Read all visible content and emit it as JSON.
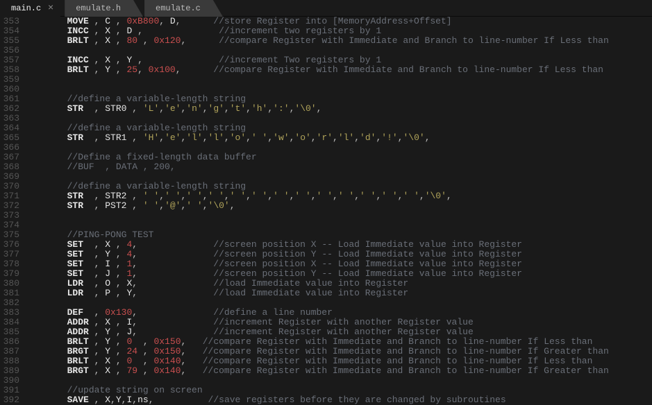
{
  "tabs": {
    "active": {
      "label": "main.c",
      "close": "×"
    },
    "others": [
      {
        "label": "emulate.h"
      },
      {
        "label": "emulate.c"
      }
    ]
  },
  "first_line": 353,
  "palette": {
    "mnemonic": "#e6e6e6",
    "register": "#e6e6e6",
    "number": "#c94f4f",
    "char": "#b0a35a",
    "comment": "#6a6f78",
    "punct": "#bfbfbf",
    "bg": "#1a1a1a"
  },
  "lines": [
    [
      {
        "c": "mn",
        "t": "MOVE"
      },
      {
        "c": "pn",
        "t": " , "
      },
      {
        "c": "rg",
        "t": "C"
      },
      {
        "c": "pn",
        "t": " , "
      },
      {
        "c": "nm",
        "t": "0xB800"
      },
      {
        "c": "pn",
        "t": ", "
      },
      {
        "c": "rg",
        "t": "D"
      },
      {
        "c": "pn",
        "t": ",      "
      },
      {
        "c": "cm",
        "t": "//store Register into [MemoryAddress+Offset]"
      }
    ],
    [
      {
        "c": "mn",
        "t": "INCC"
      },
      {
        "c": "pn",
        "t": " , "
      },
      {
        "c": "rg",
        "t": "X"
      },
      {
        "c": "pn",
        "t": " , "
      },
      {
        "c": "rg",
        "t": "D"
      },
      {
        "c": "pn",
        "t": " ,              "
      },
      {
        "c": "cm",
        "t": "//increment two registers by 1"
      }
    ],
    [
      {
        "c": "mn",
        "t": "BRLT"
      },
      {
        "c": "pn",
        "t": " , "
      },
      {
        "c": "rg",
        "t": "X"
      },
      {
        "c": "pn",
        "t": " , "
      },
      {
        "c": "nm",
        "t": "80"
      },
      {
        "c": "pn",
        "t": " , "
      },
      {
        "c": "nm",
        "t": "0x120"
      },
      {
        "c": "pn",
        "t": ",      "
      },
      {
        "c": "cm",
        "t": "//compare Register with Immediate and Branch to line-number If Less than"
      }
    ],
    [],
    [
      {
        "c": "mn",
        "t": "INCC"
      },
      {
        "c": "pn",
        "t": " , "
      },
      {
        "c": "rg",
        "t": "X"
      },
      {
        "c": "pn",
        "t": " , "
      },
      {
        "c": "rg",
        "t": "Y"
      },
      {
        "c": "pn",
        "t": " ,              "
      },
      {
        "c": "cm",
        "t": "//increment Two registers by 1"
      }
    ],
    [
      {
        "c": "mn",
        "t": "BRLT"
      },
      {
        "c": "pn",
        "t": " , "
      },
      {
        "c": "rg",
        "t": "Y"
      },
      {
        "c": "pn",
        "t": " , "
      },
      {
        "c": "nm",
        "t": "25"
      },
      {
        "c": "pn",
        "t": ", "
      },
      {
        "c": "nm",
        "t": "0x100"
      },
      {
        "c": "pn",
        "t": ",      "
      },
      {
        "c": "cm",
        "t": "//compare Register with Immediate and Branch to line-number If Less than"
      }
    ],
    [],
    [],
    [
      {
        "c": "cm",
        "t": "//define a variable-length string"
      }
    ],
    [
      {
        "c": "mn",
        "t": "STR "
      },
      {
        "c": "pn",
        "t": " , "
      },
      {
        "c": "rg",
        "t": "STR0"
      },
      {
        "c": "pn",
        "t": " , "
      },
      {
        "c": "ch",
        "t": "'L'"
      },
      {
        "c": "pn",
        "t": ","
      },
      {
        "c": "ch",
        "t": "'e'"
      },
      {
        "c": "pn",
        "t": ","
      },
      {
        "c": "ch",
        "t": "'n'"
      },
      {
        "c": "pn",
        "t": ","
      },
      {
        "c": "ch",
        "t": "'g'"
      },
      {
        "c": "pn",
        "t": ","
      },
      {
        "c": "ch",
        "t": "'t'"
      },
      {
        "c": "pn",
        "t": ","
      },
      {
        "c": "ch",
        "t": "'h'"
      },
      {
        "c": "pn",
        "t": ","
      },
      {
        "c": "ch",
        "t": "':'"
      },
      {
        "c": "pn",
        "t": ","
      },
      {
        "c": "ch",
        "t": "'\\0'"
      },
      {
        "c": "pn",
        "t": ","
      }
    ],
    [],
    [
      {
        "c": "cm",
        "t": "//define a variable-length string"
      }
    ],
    [
      {
        "c": "mn",
        "t": "STR "
      },
      {
        "c": "pn",
        "t": " , "
      },
      {
        "c": "rg",
        "t": "STR1"
      },
      {
        "c": "pn",
        "t": " , "
      },
      {
        "c": "ch",
        "t": "'H'"
      },
      {
        "c": "pn",
        "t": ","
      },
      {
        "c": "ch",
        "t": "'e'"
      },
      {
        "c": "pn",
        "t": ","
      },
      {
        "c": "ch",
        "t": "'l'"
      },
      {
        "c": "pn",
        "t": ","
      },
      {
        "c": "ch",
        "t": "'l'"
      },
      {
        "c": "pn",
        "t": ","
      },
      {
        "c": "ch",
        "t": "'o'"
      },
      {
        "c": "pn",
        "t": ","
      },
      {
        "c": "ch",
        "t": "' '"
      },
      {
        "c": "pn",
        "t": ","
      },
      {
        "c": "ch",
        "t": "'w'"
      },
      {
        "c": "pn",
        "t": ","
      },
      {
        "c": "ch",
        "t": "'o'"
      },
      {
        "c": "pn",
        "t": ","
      },
      {
        "c": "ch",
        "t": "'r'"
      },
      {
        "c": "pn",
        "t": ","
      },
      {
        "c": "ch",
        "t": "'l'"
      },
      {
        "c": "pn",
        "t": ","
      },
      {
        "c": "ch",
        "t": "'d'"
      },
      {
        "c": "pn",
        "t": ","
      },
      {
        "c": "ch",
        "t": "'!'"
      },
      {
        "c": "pn",
        "t": ","
      },
      {
        "c": "ch",
        "t": "'\\0'"
      },
      {
        "c": "pn",
        "t": ","
      }
    ],
    [],
    [
      {
        "c": "cm",
        "t": "//Define a fixed-length data buffer"
      }
    ],
    [
      {
        "c": "cm",
        "t": "//BUF  , DATA , 200,"
      }
    ],
    [],
    [
      {
        "c": "cm",
        "t": "//define a variable-length string"
      }
    ],
    [
      {
        "c": "mn",
        "t": "STR "
      },
      {
        "c": "pn",
        "t": " , "
      },
      {
        "c": "rg",
        "t": "STR2"
      },
      {
        "c": "pn",
        "t": " , "
      },
      {
        "c": "ch",
        "t": "' '"
      },
      {
        "c": "pn",
        "t": ","
      },
      {
        "c": "ch",
        "t": "' '"
      },
      {
        "c": "pn",
        "t": ","
      },
      {
        "c": "ch",
        "t": "' '"
      },
      {
        "c": "pn",
        "t": ","
      },
      {
        "c": "ch",
        "t": "' '"
      },
      {
        "c": "pn",
        "t": ","
      },
      {
        "c": "ch",
        "t": "' '"
      },
      {
        "c": "pn",
        "t": ","
      },
      {
        "c": "ch",
        "t": "' '"
      },
      {
        "c": "pn",
        "t": ","
      },
      {
        "c": "ch",
        "t": "' '"
      },
      {
        "c": "pn",
        "t": ","
      },
      {
        "c": "ch",
        "t": "' '"
      },
      {
        "c": "pn",
        "t": ","
      },
      {
        "c": "ch",
        "t": "' '"
      },
      {
        "c": "pn",
        "t": ","
      },
      {
        "c": "ch",
        "t": "' '"
      },
      {
        "c": "pn",
        "t": ","
      },
      {
        "c": "ch",
        "t": "' '"
      },
      {
        "c": "pn",
        "t": ","
      },
      {
        "c": "ch",
        "t": "' '"
      },
      {
        "c": "pn",
        "t": ","
      },
      {
        "c": "ch",
        "t": "' '"
      },
      {
        "c": "pn",
        "t": ","
      },
      {
        "c": "ch",
        "t": "'\\0'"
      },
      {
        "c": "pn",
        "t": ","
      }
    ],
    [
      {
        "c": "mn",
        "t": "STR "
      },
      {
        "c": "pn",
        "t": " , "
      },
      {
        "c": "rg",
        "t": "PST2"
      },
      {
        "c": "pn",
        "t": " , "
      },
      {
        "c": "ch",
        "t": "' '"
      },
      {
        "c": "pn",
        "t": ","
      },
      {
        "c": "ch",
        "t": "'@'"
      },
      {
        "c": "pn",
        "t": ","
      },
      {
        "c": "ch",
        "t": "' '"
      },
      {
        "c": "pn",
        "t": ","
      },
      {
        "c": "ch",
        "t": "'\\0'"
      },
      {
        "c": "pn",
        "t": ","
      }
    ],
    [],
    [],
    [
      {
        "c": "cm",
        "t": "//PING-PONG TEST"
      }
    ],
    [
      {
        "c": "mn",
        "t": "SET "
      },
      {
        "c": "pn",
        "t": " , "
      },
      {
        "c": "rg",
        "t": "X"
      },
      {
        "c": "pn",
        "t": " , "
      },
      {
        "c": "nm",
        "t": "4"
      },
      {
        "c": "pn",
        "t": ",              "
      },
      {
        "c": "cm",
        "t": "//screen position X -- Load Immediate value into Register"
      }
    ],
    [
      {
        "c": "mn",
        "t": "SET "
      },
      {
        "c": "pn",
        "t": " , "
      },
      {
        "c": "rg",
        "t": "Y"
      },
      {
        "c": "pn",
        "t": " , "
      },
      {
        "c": "nm",
        "t": "4"
      },
      {
        "c": "pn",
        "t": ",              "
      },
      {
        "c": "cm",
        "t": "//screen position Y -- Load Immediate value into Register"
      }
    ],
    [
      {
        "c": "mn",
        "t": "SET "
      },
      {
        "c": "pn",
        "t": " , "
      },
      {
        "c": "rg",
        "t": "I"
      },
      {
        "c": "pn",
        "t": " , "
      },
      {
        "c": "nm",
        "t": "1"
      },
      {
        "c": "pn",
        "t": ",              "
      },
      {
        "c": "cm",
        "t": "//screen position X -- Load Immediate value into Register"
      }
    ],
    [
      {
        "c": "mn",
        "t": "SET "
      },
      {
        "c": "pn",
        "t": " , "
      },
      {
        "c": "rg",
        "t": "J"
      },
      {
        "c": "pn",
        "t": " , "
      },
      {
        "c": "nm",
        "t": "1"
      },
      {
        "c": "pn",
        "t": ",              "
      },
      {
        "c": "cm",
        "t": "//screen position Y -- Load Immediate value into Register"
      }
    ],
    [
      {
        "c": "mn",
        "t": "LDR "
      },
      {
        "c": "pn",
        "t": " , "
      },
      {
        "c": "rg",
        "t": "O"
      },
      {
        "c": "pn",
        "t": " , "
      },
      {
        "c": "rg",
        "t": "X"
      },
      {
        "c": "pn",
        "t": ",              "
      },
      {
        "c": "cm",
        "t": "//load Immediate value into Register"
      }
    ],
    [
      {
        "c": "mn",
        "t": "LDR "
      },
      {
        "c": "pn",
        "t": " , "
      },
      {
        "c": "rg",
        "t": "P"
      },
      {
        "c": "pn",
        "t": " , "
      },
      {
        "c": "rg",
        "t": "Y"
      },
      {
        "c": "pn",
        "t": ",              "
      },
      {
        "c": "cm",
        "t": "//load Immediate value into Register"
      }
    ],
    [],
    [
      {
        "c": "mn",
        "t": "DEF "
      },
      {
        "c": "pn",
        "t": " , "
      },
      {
        "c": "nm",
        "t": "0x130"
      },
      {
        "c": "pn",
        "t": ",              "
      },
      {
        "c": "cm",
        "t": "//define a line number"
      }
    ],
    [
      {
        "c": "mn",
        "t": "ADDR"
      },
      {
        "c": "pn",
        "t": " , "
      },
      {
        "c": "rg",
        "t": "X"
      },
      {
        "c": "pn",
        "t": " , "
      },
      {
        "c": "rg",
        "t": "I"
      },
      {
        "c": "pn",
        "t": ",              "
      },
      {
        "c": "cm",
        "t": "//increment Register with another Register value"
      }
    ],
    [
      {
        "c": "mn",
        "t": "ADDR"
      },
      {
        "c": "pn",
        "t": " , "
      },
      {
        "c": "rg",
        "t": "Y"
      },
      {
        "c": "pn",
        "t": " , "
      },
      {
        "c": "rg",
        "t": "J"
      },
      {
        "c": "pn",
        "t": ",              "
      },
      {
        "c": "cm",
        "t": "//increment Register with another Register value"
      }
    ],
    [
      {
        "c": "mn",
        "t": "BRLT"
      },
      {
        "c": "pn",
        "t": " , "
      },
      {
        "c": "rg",
        "t": "Y"
      },
      {
        "c": "pn",
        "t": " , "
      },
      {
        "c": "nm",
        "t": "0"
      },
      {
        "c": "pn",
        "t": "  , "
      },
      {
        "c": "nm",
        "t": "0x150"
      },
      {
        "c": "pn",
        "t": ",   "
      },
      {
        "c": "cm",
        "t": "//compare Register with Immediate and Branch to line-number If Less than"
      }
    ],
    [
      {
        "c": "mn",
        "t": "BRGT"
      },
      {
        "c": "pn",
        "t": " , "
      },
      {
        "c": "rg",
        "t": "Y"
      },
      {
        "c": "pn",
        "t": " , "
      },
      {
        "c": "nm",
        "t": "24"
      },
      {
        "c": "pn",
        "t": " , "
      },
      {
        "c": "nm",
        "t": "0x150"
      },
      {
        "c": "pn",
        "t": ",   "
      },
      {
        "c": "cm",
        "t": "//compare Register with Immediate and Branch to line-number If Greater than"
      }
    ],
    [
      {
        "c": "mn",
        "t": "BRLT"
      },
      {
        "c": "pn",
        "t": " , "
      },
      {
        "c": "rg",
        "t": "X"
      },
      {
        "c": "pn",
        "t": " , "
      },
      {
        "c": "nm",
        "t": "0"
      },
      {
        "c": "pn",
        "t": "  , "
      },
      {
        "c": "nm",
        "t": "0x140"
      },
      {
        "c": "pn",
        "t": ",   "
      },
      {
        "c": "cm",
        "t": "//compare Register with Immediate and Branch to line-number If Less than"
      }
    ],
    [
      {
        "c": "mn",
        "t": "BRGT"
      },
      {
        "c": "pn",
        "t": " , "
      },
      {
        "c": "rg",
        "t": "X"
      },
      {
        "c": "pn",
        "t": " , "
      },
      {
        "c": "nm",
        "t": "79"
      },
      {
        "c": "pn",
        "t": " , "
      },
      {
        "c": "nm",
        "t": "0x140"
      },
      {
        "c": "pn",
        "t": ",   "
      },
      {
        "c": "cm",
        "t": "//compare Register with Immediate and Branch to line-number If Greater than"
      }
    ],
    [],
    [
      {
        "c": "cm",
        "t": "//update string on screen"
      }
    ],
    [
      {
        "c": "mn",
        "t": "SAVE"
      },
      {
        "c": "pn",
        "t": " , "
      },
      {
        "c": "rg",
        "t": "X"
      },
      {
        "c": "pn",
        "t": ","
      },
      {
        "c": "rg",
        "t": "Y"
      },
      {
        "c": "pn",
        "t": ","
      },
      {
        "c": "rg",
        "t": "I"
      },
      {
        "c": "pn",
        "t": ","
      },
      {
        "c": "rg",
        "t": "ns"
      },
      {
        "c": "pn",
        "t": ",          "
      },
      {
        "c": "cm",
        "t": "//save registers before they are changed by subroutines"
      }
    ]
  ]
}
